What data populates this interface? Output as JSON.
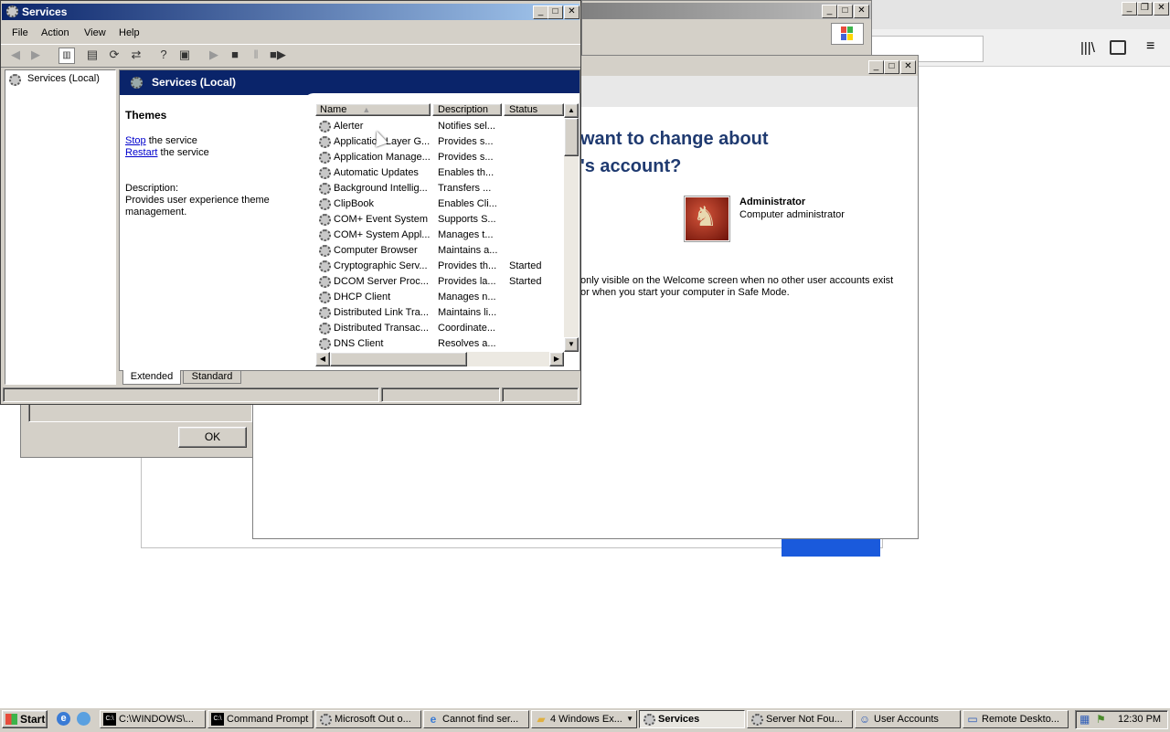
{
  "bg_window2": {
    "right_text": ""
  },
  "browser": {
    "toolbar_icons": [
      "library-icon",
      "sidebar-icon",
      "menu-icon"
    ]
  },
  "user_accounts": {
    "heading_line1": "want to change about",
    "heading_line2": "'s account?",
    "account_name": "Administrator",
    "account_type": "Computer administrator",
    "note_line1": "only visible on the Welcome screen when no other user accounts exist",
    "note_line2": "or when you start your computer in Safe Mode."
  },
  "dialog": {
    "ok_label": "OK"
  },
  "services": {
    "title": "Services",
    "menu": [
      "File",
      "Action",
      "View",
      "Help"
    ],
    "tree_item": "Services (Local)",
    "header_title": "Services (Local)",
    "selected_service": "Themes",
    "stop_link": "Stop",
    "stop_suffix": " the service",
    "restart_link": "Restart",
    "restart_suffix": " the service",
    "description_label": "Description:",
    "description_text": "Provides user experience theme management.",
    "columns": {
      "name": "Name",
      "description": "Description",
      "status": "Status"
    },
    "rows": [
      {
        "name": "Alerter",
        "description": "Notifies sel...",
        "status": ""
      },
      {
        "name": "Application Layer G...",
        "description": "Provides s...",
        "status": ""
      },
      {
        "name": "Application Manage...",
        "description": "Provides s...",
        "status": ""
      },
      {
        "name": "Automatic Updates",
        "description": "Enables th...",
        "status": ""
      },
      {
        "name": "Background Intellig...",
        "description": "Transfers ...",
        "status": ""
      },
      {
        "name": "ClipBook",
        "description": "Enables Cli...",
        "status": ""
      },
      {
        "name": "COM+ Event System",
        "description": "Supports S...",
        "status": ""
      },
      {
        "name": "COM+ System Appl...",
        "description": "Manages t...",
        "status": ""
      },
      {
        "name": "Computer Browser",
        "description": "Maintains a...",
        "status": ""
      },
      {
        "name": "Cryptographic Serv...",
        "description": "Provides th...",
        "status": "Started"
      },
      {
        "name": "DCOM Server Proc...",
        "description": "Provides la...",
        "status": "Started"
      },
      {
        "name": "DHCP Client",
        "description": "Manages n...",
        "status": ""
      },
      {
        "name": "Distributed Link Tra...",
        "description": "Maintains li...",
        "status": ""
      },
      {
        "name": "Distributed Transac...",
        "description": "Coordinate...",
        "status": ""
      },
      {
        "name": "DNS Client",
        "description": "Resolves a...",
        "status": ""
      }
    ],
    "tabs": {
      "extended": "Extended",
      "standard": "Standard"
    }
  },
  "taskbar": {
    "start_label": "Start",
    "buttons": [
      {
        "label": "C:\\WINDOWS\\...",
        "icon": "cmd-icon"
      },
      {
        "label": "Command Prompt",
        "icon": "cmd-icon"
      },
      {
        "label": "Microsoft Out o...",
        "icon": "gear-icon"
      },
      {
        "label": "Cannot find ser...",
        "icon": "ie-page-icon"
      },
      {
        "label": "4 Windows Ex...",
        "icon": "folder-icon"
      },
      {
        "label": "Services",
        "icon": "gear-icon"
      },
      {
        "label": "Server Not Fou...",
        "icon": "gear-icon"
      },
      {
        "label": "User Accounts",
        "icon": "users-icon"
      },
      {
        "label": "Remote Deskto...",
        "icon": "remote-desktop-icon"
      }
    ],
    "clock": "12:30 PM"
  }
}
